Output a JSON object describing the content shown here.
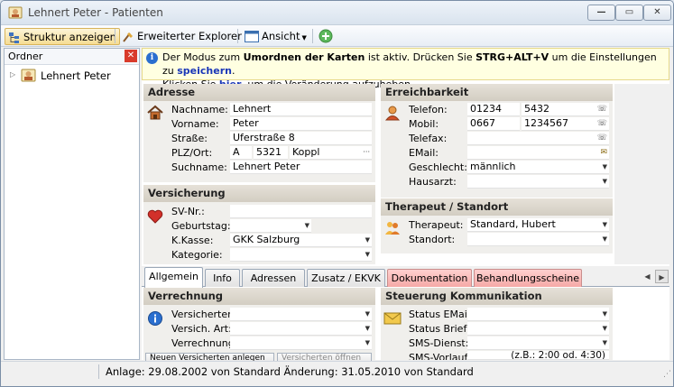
{
  "window": {
    "title": "Lehnert Peter - Patienten"
  },
  "toolbar": {
    "structure_label": "Struktur anzeigen",
    "explorer_label": "Erweiterter Explorer",
    "view_label": "Ansicht"
  },
  "sidebar": {
    "header": "Ordner",
    "items": [
      {
        "label": "Lehnert Peter"
      }
    ]
  },
  "info": {
    "t1": "Der Modus zum ",
    "t2": "Umordnen der Karten",
    "t3": " ist aktiv. Drücken Sie ",
    "t4": "STRG+ALT+V",
    "t5": " um die Einstellungen zu ",
    "link1": "speichern",
    "t6": ".",
    "t7": "Klicken Sie ",
    "link2": "hier",
    "t8": ", um die Veränderung aufzuheben."
  },
  "adresse": {
    "title": "Adresse",
    "nachname_label": "Nachname:",
    "nachname": "Lehnert",
    "vorname_label": "Vorname:",
    "vorname": "Peter",
    "strasse_label": "Straße:",
    "strasse": "Uferstraße 8",
    "plz_label": "PLZ/Ort:",
    "land": "A",
    "plz": "5321",
    "ort": "Koppl",
    "ort_more": "···",
    "suchname_label": "Suchname:",
    "suchname": "Lehnert Peter"
  },
  "erreichbarkeit": {
    "title": "Erreichbarkeit",
    "telefon_label": "Telefon:",
    "telefon_vorwahl": "01234",
    "telefon_nr": "5432",
    "mobil_label": "Mobil:",
    "mobil_vorwahl": "0667",
    "mobil_nr": "1234567",
    "telefax_label": "Telefax:",
    "email_label": "EMail:",
    "geschlecht_label": "Geschlecht:",
    "geschlecht": "männlich",
    "hausarzt_label": "Hausarzt:"
  },
  "versicherung": {
    "title": "Versicherung",
    "svnr_label": "SV-Nr.:",
    "geburtstag_label": "Geburtstag:",
    "kkasse_label": "K.Kasse:",
    "kkasse": "GKK Salzburg",
    "kategorie_label": "Kategorie:"
  },
  "therapeut": {
    "title": "Therapeut / Standort",
    "therapeut_label": "Therapeut:",
    "therapeut": "Standard, Hubert",
    "standort_label": "Standort:"
  },
  "tabs": [
    {
      "label": "Allgemein"
    },
    {
      "label": "Info"
    },
    {
      "label": "Adressen"
    },
    {
      "label": "Zusatz / EKVK"
    },
    {
      "label": "Dokumentation"
    },
    {
      "label": "Behandlungsscheine"
    }
  ],
  "verrechnung": {
    "title": "Verrechnung",
    "versicherter_label": "Versicherter:",
    "versich_art_label": "Versich. Art:",
    "verrechnung_label": "Verrechnung:",
    "btn1": "Neuen Versicherten anlegen",
    "btn2": "Versicherten öffnen"
  },
  "kommunikation": {
    "title": "Steuerung Kommunikation",
    "email_label": "Status EMail:",
    "brief_label": "Status Brief:",
    "sms_label": "SMS-Dienst:",
    "smsvorlauf_label": "SMS-Vorlauf:",
    "smsvorlauf_hint": "(z.B.: 2:00 od. 4:30)"
  },
  "status": {
    "text": "Anlage: 29.08.2002 von Standard  Änderung: 31.05.2010 von Standard"
  },
  "colors": {
    "accent": "#1a37b8",
    "info_bg": "#ffffe1",
    "tab_red": "#f5a9a6"
  }
}
